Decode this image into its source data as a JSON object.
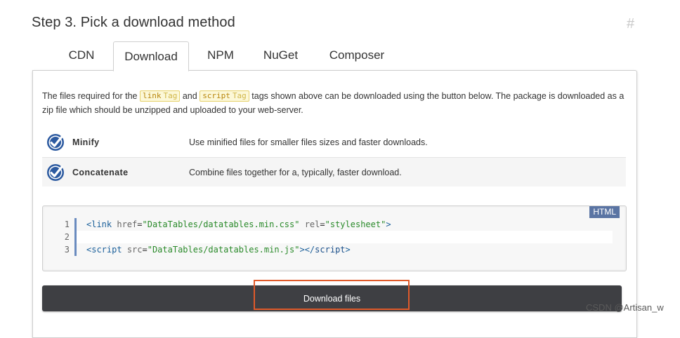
{
  "heading": {
    "title": "Step 3. Pick a download method",
    "anchor": "#"
  },
  "tabs": [
    {
      "label": "CDN",
      "active": false
    },
    {
      "label": "Download",
      "active": true
    },
    {
      "label": "NPM",
      "active": false
    },
    {
      "label": "NuGet",
      "active": false
    },
    {
      "label": "Composer",
      "active": false
    }
  ],
  "intro": {
    "part1": "The files required for the",
    "link_chip": "link",
    "chip_suffix": "Tag",
    "part2": "and",
    "script_chip": "script",
    "part3": "tags shown above can be downloaded using the button below. The package is downloaded as a zip file which should be unzipped and uploaded to your web-server."
  },
  "options": [
    {
      "name": "Minify",
      "description": "Use minified files for smaller files sizes and faster downloads.",
      "checked": true
    },
    {
      "name": "Concatenate",
      "description": "Combine files together for a, typically, faster download.",
      "checked": true
    }
  ],
  "code": {
    "language": "HTML",
    "line_numbers": [
      "1",
      "2",
      "3"
    ],
    "line1": {
      "open": "<link",
      "attr1": "href",
      "eq1": "=",
      "val1": "\"DataTables/datatables.min.css\"",
      "attr2": "rel",
      "eq2": "=",
      "val2": "\"stylesheet\"",
      "close": ">"
    },
    "line3": {
      "open": "<script",
      "attr1": "src",
      "eq1": "=",
      "val1": "\"DataTables/datatables.min.js\"",
      "mid": "></",
      "tag": "script",
      "close": ">"
    }
  },
  "download_button": {
    "label": "Download files"
  },
  "watermark": "CSDN @Artisan_w",
  "colors": {
    "button_bg": "#3e3f43",
    "highlight": "#e05a2a",
    "check_blue": "#2c5aa0",
    "language_badge": "#5a74a3"
  }
}
